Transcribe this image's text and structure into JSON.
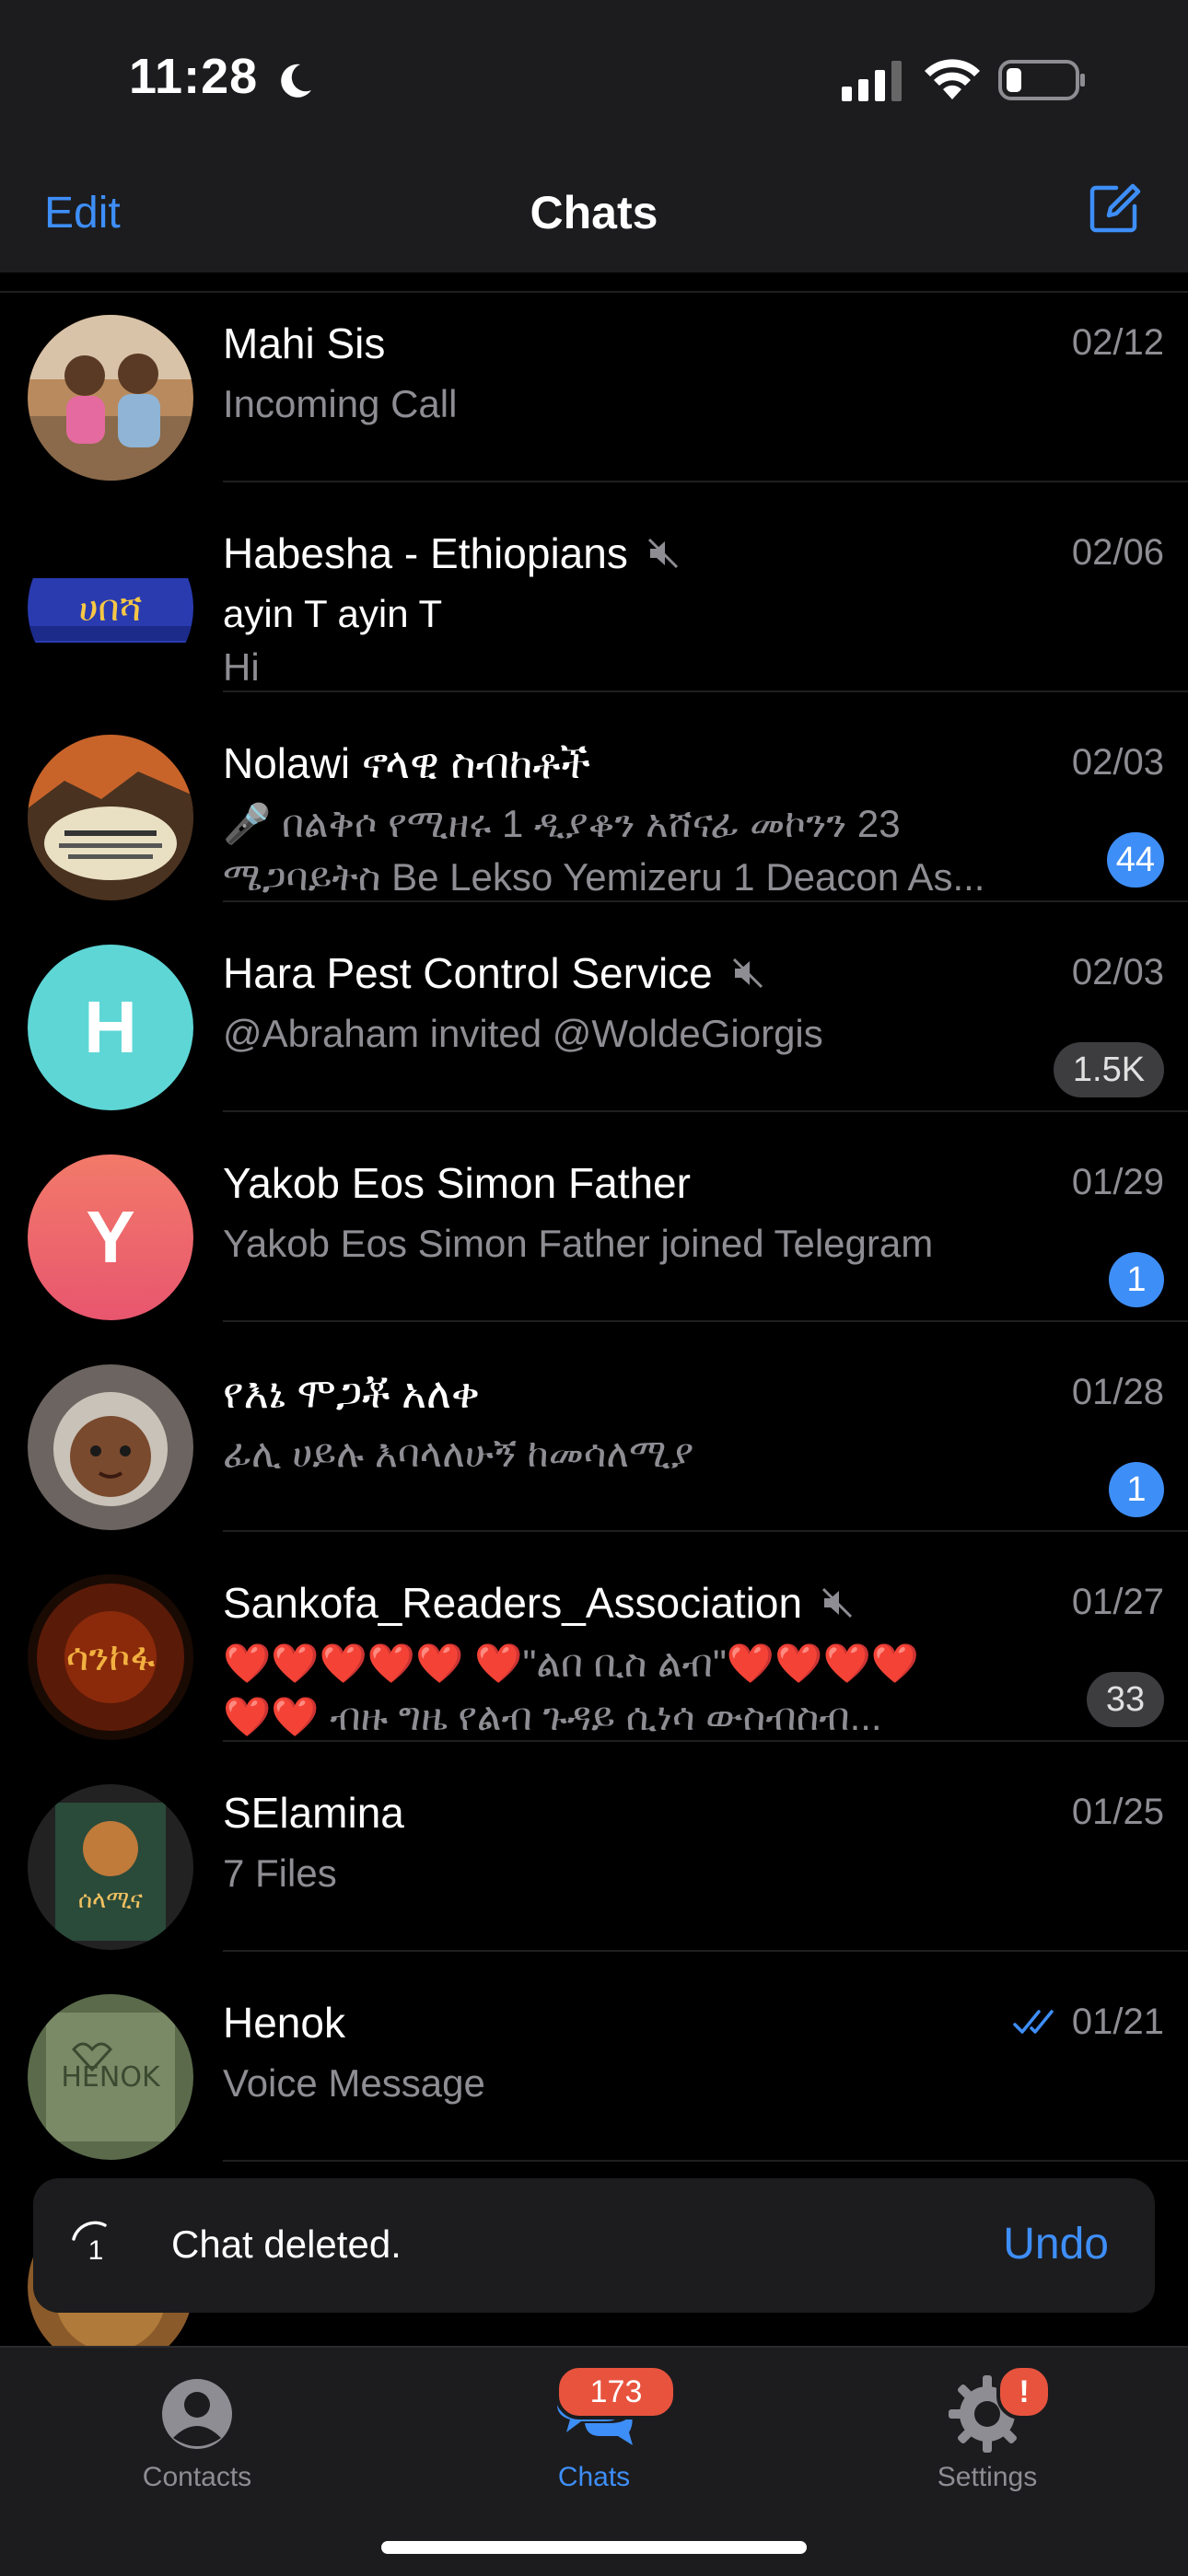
{
  "status_bar": {
    "time": "11:28"
  },
  "nav": {
    "edit_label": "Edit",
    "title": "Chats",
    "compose_icon": "compose-icon"
  },
  "chats": [
    {
      "name": "Mahi Sis",
      "date": "02/12",
      "preview": [
        "Incoming Call"
      ],
      "avatar": "photo-children",
      "muted": false
    },
    {
      "name": "Habesha - Ethiopians",
      "date": "02/06",
      "sender": "ayin T ayin T",
      "preview": [
        "Hi"
      ],
      "avatar": "photo-habesha-banner",
      "muted": true
    },
    {
      "name": "Nolawi ኖላዊ ስብከቶች",
      "date": "02/03",
      "preview": [
        "🎤 በልቅሶ የሚዘሩ 1 ዲያቆን አሸናፊ መኮንን 23",
        "ሜጋባይትስ Be Lekso Yemizeru 1 Deacon As..."
      ],
      "badge": "44",
      "avatar": "photo-sunset-poster",
      "muted": false
    },
    {
      "name": "Hara Pest Control Service",
      "date": "02/03",
      "preview": [
        "@Abraham invited @WoldeGiorgis"
      ],
      "badge": "1.5K",
      "badge_muted": true,
      "avatar_letter": "H",
      "avatar_color": "#5ed6d6",
      "muted": true
    },
    {
      "name": "Yakob Eos Simon Father",
      "date": "01/29",
      "preview": [
        "Yakob Eos Simon Father joined Telegram"
      ],
      "badge": "1",
      "avatar_letter": "Y",
      "avatar_color": "#ef6a6a",
      "muted": false
    },
    {
      "name": "የእኔ ሞጋቾ አለቀ",
      "date": "01/28",
      "preview": [
        "ፊሊ ሀይሉ እባላለሁኝ ከመሳለሚያ"
      ],
      "badge": "1",
      "avatar": "photo-child-headscarf",
      "muted": false
    },
    {
      "name": "Sankofa_Readers_Association",
      "date": "01/27",
      "preview": [
        "❤️❤️❤️❤️❤️ ❤️\"ልበ ቢስ ልብ\"❤️❤️❤️❤️",
        "❤️❤️ ብዙ ግዜ የልብ ጉዳይ ሲነሳ ውስብስብ..."
      ],
      "badge": "33",
      "badge_muted": true,
      "avatar": "logo-sankofa",
      "muted": true
    },
    {
      "name": "SElamina",
      "date": "01/25",
      "preview": [
        "7 Files"
      ],
      "avatar": "photo-book-cover",
      "muted": false
    },
    {
      "name": "Henok",
      "date": "01/21",
      "preview": [
        "Voice Message"
      ],
      "avatar": "photo-henok-drawing",
      "read": true,
      "muted": false
    }
  ],
  "toast": {
    "message": "Chat deleted.",
    "undo_label": "Undo",
    "timer_value": "1"
  },
  "tabs": [
    {
      "label": "Contacts",
      "icon": "person-circle-icon"
    },
    {
      "label": "Chats",
      "icon": "chat-bubbles-icon",
      "badge": "173",
      "active": true
    },
    {
      "label": "Settings",
      "icon": "gear-icon",
      "badge": "!"
    }
  ],
  "colors": {
    "accent": "#3e8ef7",
    "badge_red": "#e8533e",
    "background": "#000000",
    "bar": "#1c1c1e"
  }
}
